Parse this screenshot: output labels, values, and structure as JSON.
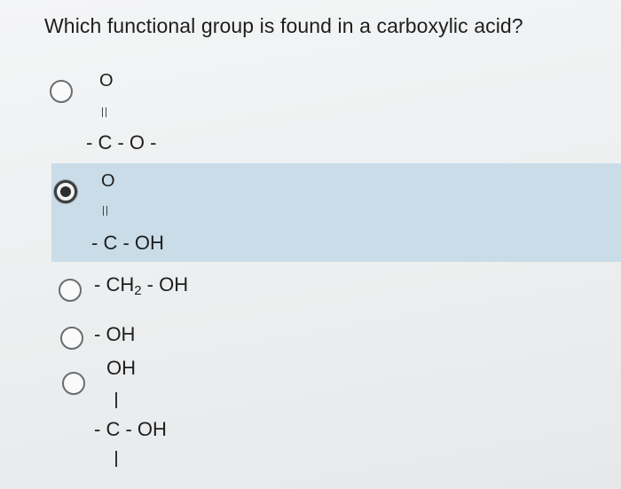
{
  "question": "Which functional group is found in a carboxylic acid?",
  "options": [
    {
      "id": "ester",
      "selected": false,
      "top_atom": "O",
      "main_line": "- C - O -"
    },
    {
      "id": "carboxyl",
      "selected": true,
      "top_atom": "O",
      "main_line": "- C - OH"
    },
    {
      "id": "ch2oh",
      "selected": false,
      "main_prefix": "- CH",
      "main_sub": "2",
      "main_suffix": " - OH"
    },
    {
      "id": "hydroxyl",
      "selected": false,
      "main_line": "- OH"
    },
    {
      "id": "diol",
      "selected": false,
      "top_atom": "OH",
      "main_line": "- C - OH"
    }
  ],
  "colors": {
    "selected_highlight": "#c9dce8",
    "background": "#eceeef",
    "text": "#1e1e1e"
  }
}
